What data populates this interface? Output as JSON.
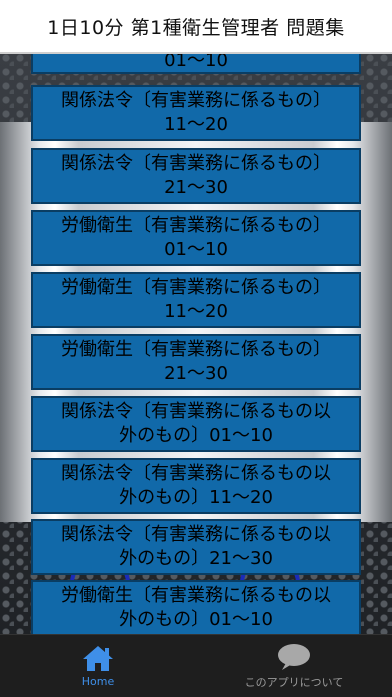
{
  "app": {
    "title": "1日10分 第1種衛生管理者 問題集"
  },
  "menu": [
    {
      "line1": "01～10",
      "line2": ""
    },
    {
      "line1": "関係法令〔有害業務に係るもの〕",
      "line2": "11～20"
    },
    {
      "line1": "関係法令〔有害業務に係るもの〕",
      "line2": "21～30"
    },
    {
      "line1": "労働衛生〔有害業務に係るもの〕",
      "line2": "01～10"
    },
    {
      "line1": "労働衛生〔有害業務に係るもの〕",
      "line2": "11～20"
    },
    {
      "line1": "労働衛生〔有害業務に係るもの〕",
      "line2": "21～30"
    },
    {
      "line1": "関係法令〔有害業務に係るもの以",
      "line2": "外のもの〕01～10"
    },
    {
      "line1": "関係法令〔有害業務に係るもの以",
      "line2": "外のもの〕11～20"
    },
    {
      "line1": "関係法令〔有害業務に係るもの以",
      "line2": "外のもの〕21～30"
    },
    {
      "line1": "労働衛生〔有害業務に係るもの以",
      "line2": "外のもの〕01～10"
    }
  ],
  "tabs": [
    {
      "label": "Home",
      "icon": "home-icon",
      "active": true
    },
    {
      "label": "このアプリについて",
      "icon": "speech-bubble-icon",
      "active": false
    }
  ],
  "colors": {
    "button": "#1169a9",
    "accent": "#3f8fe8",
    "tabbar": "#1e1e1e"
  }
}
